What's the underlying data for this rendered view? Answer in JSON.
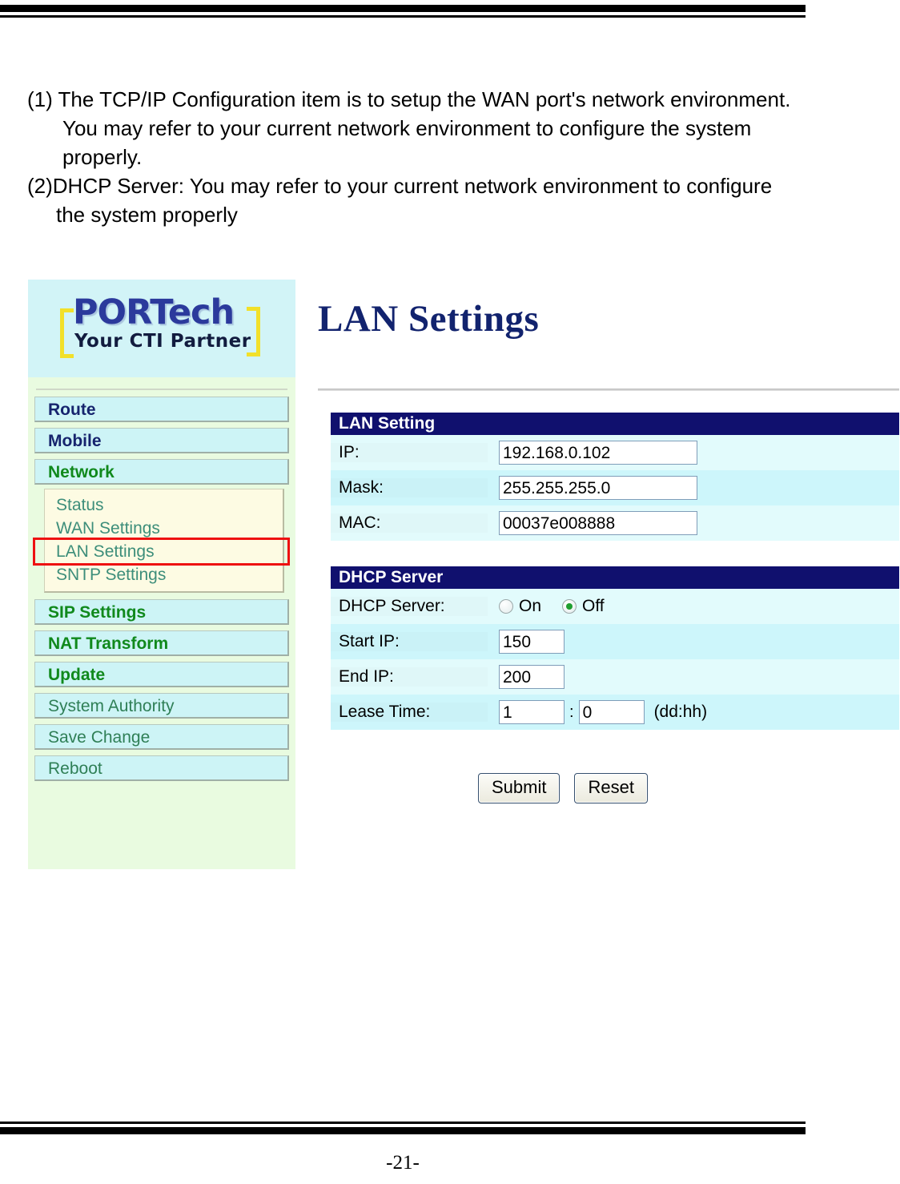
{
  "document": {
    "page_number": "-21-",
    "intro": {
      "item1": "(1) The TCP/IP Configuration item is to setup the WAN port's network environment. You may refer to your current network environment to configure the system properly.",
      "item2": "(2)DHCP Server: You may refer to your current network environment to configure the system properly"
    }
  },
  "device_ui": {
    "logo": {
      "main": "PORTech",
      "tagline": "Your CTI Partner",
      "main_color": "#2b3a9c",
      "bracket_color": "#f2e02a"
    },
    "sidebar": {
      "items": [
        {
          "label": "Route",
          "style": "navy"
        },
        {
          "label": "Mobile",
          "style": "navy"
        },
        {
          "label": "Network",
          "style": "green-b"
        }
      ],
      "submenu": [
        {
          "label": "Status",
          "selected": false
        },
        {
          "label": "WAN Settings",
          "selected": false
        },
        {
          "label": "LAN Settings",
          "selected": true
        },
        {
          "label": "SNTP Settings",
          "selected": false
        }
      ],
      "items2": [
        {
          "label": "SIP Settings",
          "style": "green-b"
        },
        {
          "label": "NAT Transform",
          "style": "green-b"
        },
        {
          "label": "Update",
          "style": "green-b"
        },
        {
          "label": "System Authority",
          "style": "plain"
        },
        {
          "label": "Save Change",
          "style": "plain"
        },
        {
          "label": "Reboot",
          "style": "plain"
        }
      ],
      "highlight_color": "#ee1111"
    },
    "main": {
      "title": "LAN Settings",
      "lan_setting": {
        "header": "LAN Setting",
        "rows": [
          {
            "label": "IP:",
            "value": "192.168.0.102"
          },
          {
            "label": "Mask:",
            "value": "255.255.255.0"
          },
          {
            "label": "MAC:",
            "value": "00037e008888"
          }
        ]
      },
      "dhcp_server": {
        "header": "DHCP Server",
        "toggle_label": "DHCP Server:",
        "options": [
          {
            "label": "On",
            "selected": false
          },
          {
            "label": "Off",
            "selected": true
          }
        ],
        "start_ip": {
          "label": "Start IP:",
          "value": "150"
        },
        "end_ip": {
          "label": "End IP:",
          "value": "200"
        },
        "lease_time": {
          "label": "Lease Time:",
          "days": "1",
          "separator": ":",
          "hours": "0",
          "unit": "(dd:hh)"
        }
      },
      "buttons": {
        "submit": "Submit",
        "reset": "Reset"
      }
    }
  }
}
